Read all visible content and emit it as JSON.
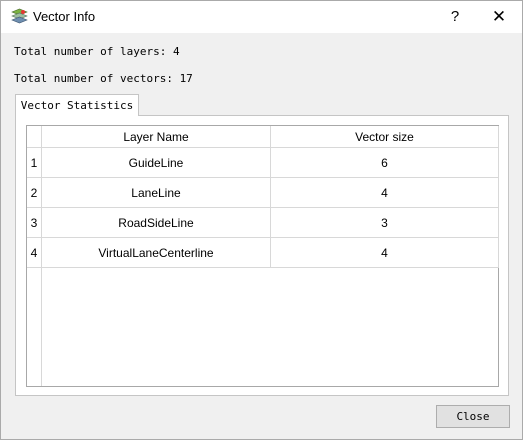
{
  "window": {
    "title": "Vector Info",
    "help_label": "?",
    "close_label": "✕"
  },
  "info": {
    "total_layers": "Total number of layers: 4",
    "total_vectors": "Total number of vectors: 17"
  },
  "tab": {
    "label": "Vector Statistics"
  },
  "table": {
    "headers": [
      "Layer Name",
      "Vector size"
    ],
    "rows": [
      {
        "index": "1",
        "layer": "GuideLine",
        "size": "6"
      },
      {
        "index": "2",
        "layer": "LaneLine",
        "size": "4"
      },
      {
        "index": "3",
        "layer": "RoadSideLine",
        "size": "3"
      },
      {
        "index": "4",
        "layer": "VirtualLaneCenterline",
        "size": "4"
      }
    ]
  },
  "footer": {
    "close_label": "Close"
  },
  "icons": {
    "app": "map-layers-icon",
    "help": "question-icon",
    "close": "close-icon"
  }
}
